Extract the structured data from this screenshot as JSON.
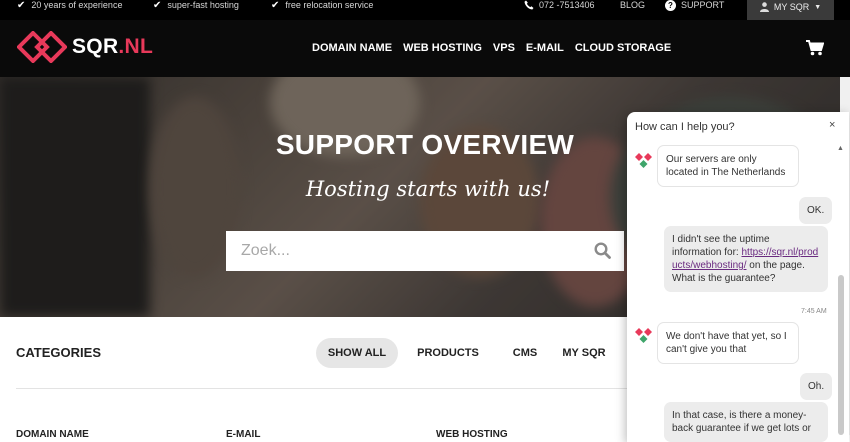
{
  "topbar": {
    "usps": [
      "20 years of experience",
      "super-fast hosting",
      "free relocation service"
    ],
    "phone": "072 -7513406",
    "blog": "BLOG",
    "support": "SUPPORT",
    "my_sqr": "MY SQR"
  },
  "logo": {
    "name": "SQR",
    "tld": ".NL"
  },
  "nav": {
    "links": [
      "DOMAIN NAME",
      "WEB HOSTING",
      "VPS",
      "E-MAIL",
      "CLOUD STORAGE"
    ]
  },
  "hero": {
    "title": "SUPPORT OVERVIEW",
    "subtitle": "Hosting starts with us!",
    "search_placeholder": "Zoek..."
  },
  "categories": {
    "title": "CATEGORIES",
    "tabs": [
      "SHOW ALL",
      "PRODUCTS",
      "CMS",
      "MY SQR"
    ],
    "columns": [
      "DOMAIN NAME",
      "E-MAIL",
      "WEB HOSTING"
    ]
  },
  "chat": {
    "header": "How can I help you?",
    "close": "×",
    "messages": [
      {
        "from": "bot",
        "text": "Our servers are only located in The Netherlands"
      },
      {
        "from": "user",
        "text": "OK."
      },
      {
        "from": "user",
        "text_before": "I didn't see the uptime information for:",
        "link": "https://sqr.nl/products/webhosting/",
        "text_after": "on the page. What is the guarantee?"
      },
      {
        "from": "bot",
        "text": "We don't have that yet, so I can't give you that"
      },
      {
        "from": "user",
        "text": "Oh."
      },
      {
        "from": "user",
        "text": "In that case, is there a money-back guarantee if we get lots or"
      }
    ],
    "timestamp": "7:45 AM"
  },
  "colors": {
    "brand_pink": "#e8395a",
    "topbar_bg": "#000000",
    "nav_bg": "#0a0a0a",
    "link_purple": "#6a2a80"
  }
}
